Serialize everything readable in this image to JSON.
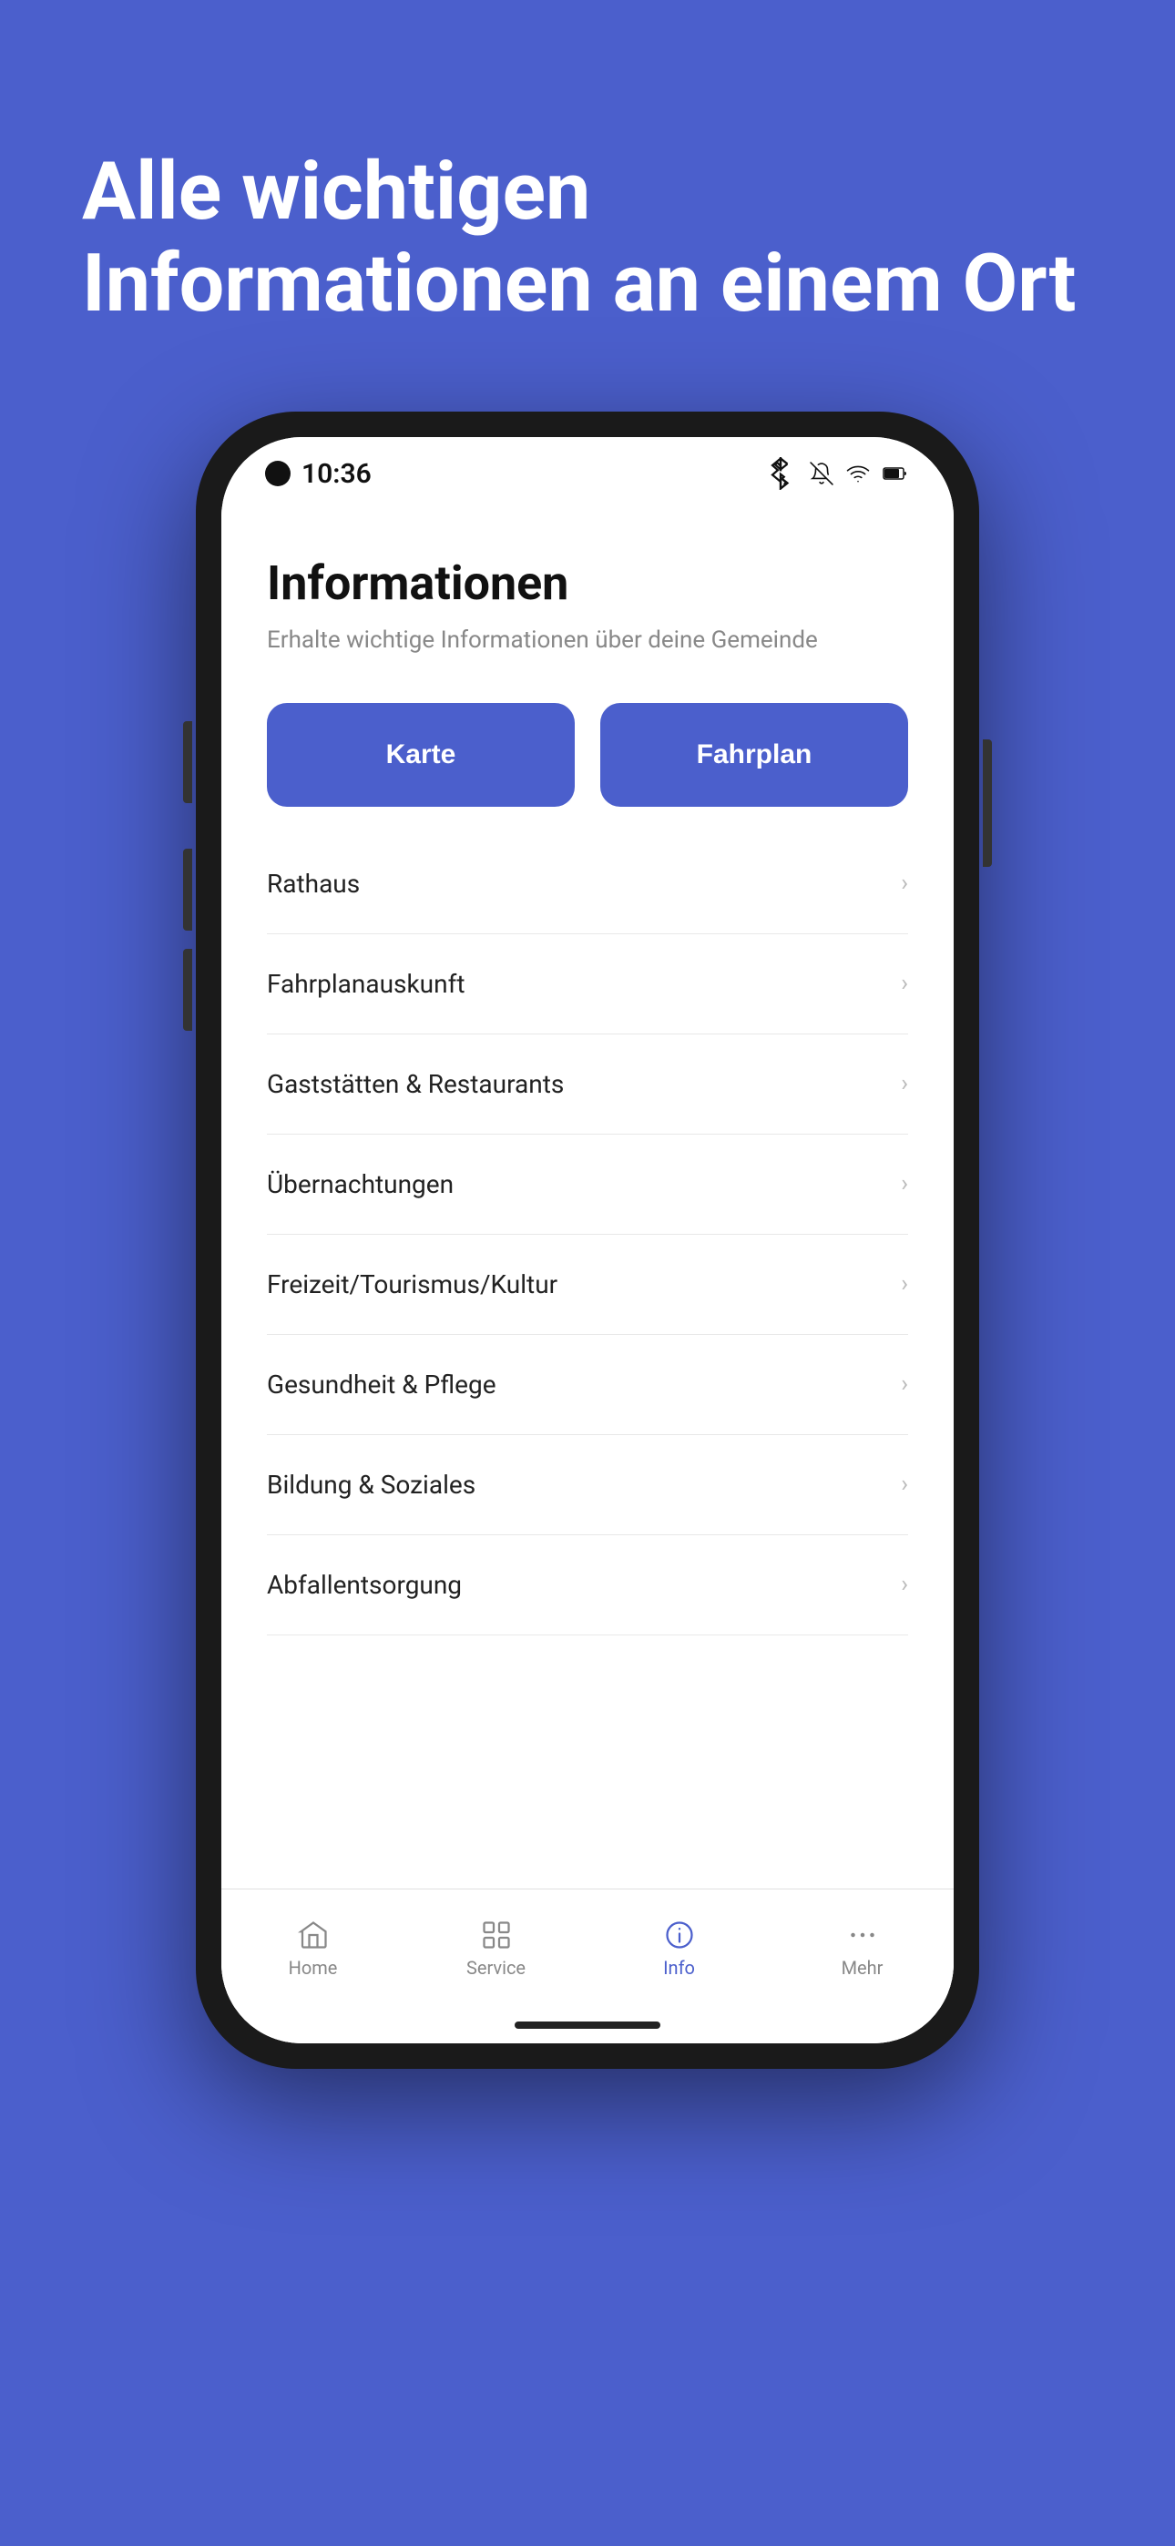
{
  "background_color": "#4B5FCC",
  "hero": {
    "title": "Alle wichtigen Informationen an einem Ort"
  },
  "phone": {
    "status_bar": {
      "time": "10:36",
      "icons": [
        "bluetooth",
        "mute",
        "wifi",
        "battery"
      ]
    },
    "app": {
      "title": "Informationen",
      "subtitle": "Erhalte wichtige Informationen über deine Gemeinde",
      "quick_buttons": [
        {
          "label": "Karte"
        },
        {
          "label": "Fahrplan"
        }
      ],
      "menu_items": [
        {
          "label": "Rathaus"
        },
        {
          "label": "Fahrplanauskunft"
        },
        {
          "label": "Gaststätten & Restaurants"
        },
        {
          "label": "Übernachtungen"
        },
        {
          "label": "Freizeit/Tourismus/Kultur"
        },
        {
          "label": "Gesundheit & Pflege"
        },
        {
          "label": "Bildung & Soziales"
        },
        {
          "label": "Abfallentsorgung"
        }
      ]
    },
    "bottom_nav": {
      "items": [
        {
          "id": "home",
          "label": "Home",
          "active": false,
          "icon": "home"
        },
        {
          "id": "service",
          "label": "Service",
          "active": false,
          "icon": "grid"
        },
        {
          "id": "info",
          "label": "Info",
          "active": true,
          "icon": "info-circle"
        },
        {
          "id": "mehr",
          "label": "Mehr",
          "active": false,
          "icon": "more"
        }
      ]
    }
  }
}
